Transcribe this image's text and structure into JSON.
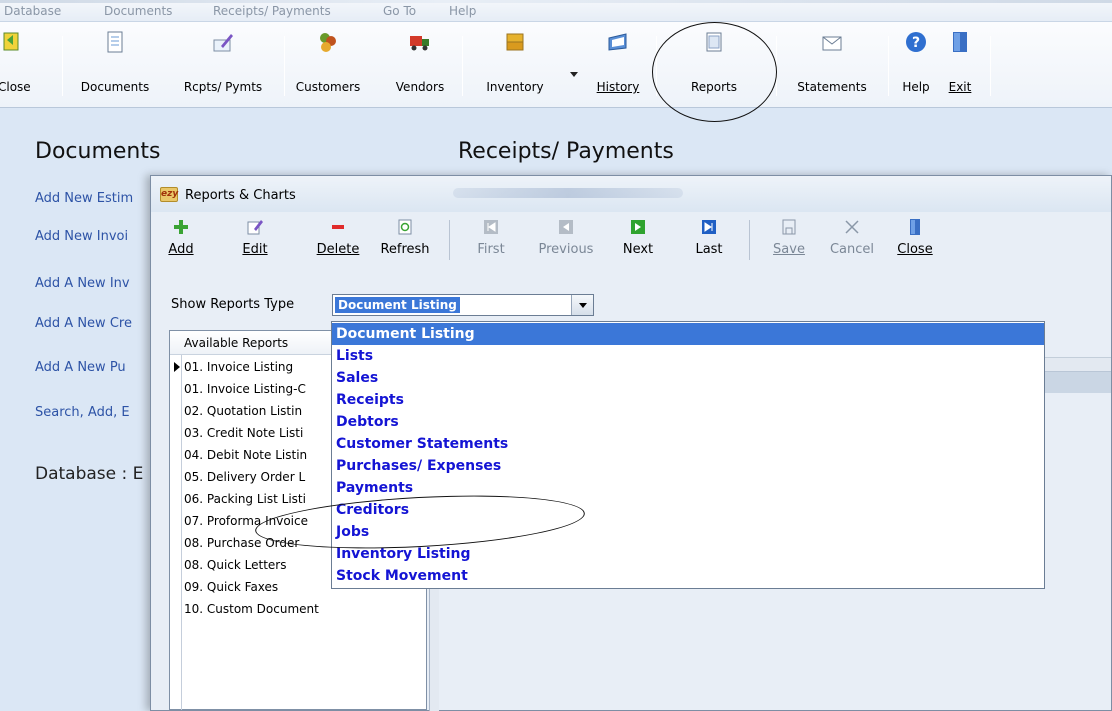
{
  "menubar": [
    "Database",
    "Documents",
    "Receipts/ Payments",
    "Go To",
    "Help"
  ],
  "toolbar": {
    "close": "Close",
    "documents": "Documents",
    "rcpts": "Rcpts/ Pymts",
    "customers": "Customers",
    "vendors": "Vendors",
    "inventory": "Inventory",
    "history": "History",
    "reports": "Reports",
    "statements": "Statements",
    "help": "Help",
    "exit": "Exit"
  },
  "main": {
    "documents_title": "Documents",
    "receipts_title": "Receipts/ Payments",
    "links": [
      "Add New Estim",
      "Add New Invoi",
      "Add A New Inv",
      "Add A New Cre",
      "Add A New Pu",
      "Search, Add, E"
    ],
    "database_label": "Database : E"
  },
  "dialog": {
    "title": "Reports & Charts",
    "icon_text": "ezy",
    "toolbar": {
      "add": "Add",
      "edit": "Edit",
      "delete": "Delete",
      "refresh": "Refresh",
      "first": "First",
      "previous": "Previous",
      "next": "Next",
      "last": "Last",
      "save": "Save",
      "cancel": "Cancel",
      "close": "Close"
    },
    "report_type_label": "Show Reports Type",
    "report_type_value": "Document Listing",
    "list_header": "Available Reports",
    "reports": [
      "01. Invoice Listing",
      "01. Invoice Listing-C",
      "02. Quotation Listin",
      "03. Credit Note Listi",
      "04. Debit Note Listin",
      "05. Delivery Order L",
      "06. Packing List Listi",
      "07. Proforma Invoice",
      "08. Purchase Order",
      "08. Quick Letters",
      "09. Quick Faxes",
      "10. Custom Document"
    ],
    "dropdown_options": [
      "Document Listing",
      "Lists",
      "Sales",
      "Receipts",
      "Debtors",
      "Customer Statements",
      "Purchases/ Expenses",
      "Payments",
      "Creditors",
      "Jobs",
      "Inventory Listing",
      "Stock Movement"
    ]
  },
  "colors": {
    "link": "#2d53a6",
    "dropdown_text": "#1414d4",
    "selection": "#3b77d8"
  }
}
